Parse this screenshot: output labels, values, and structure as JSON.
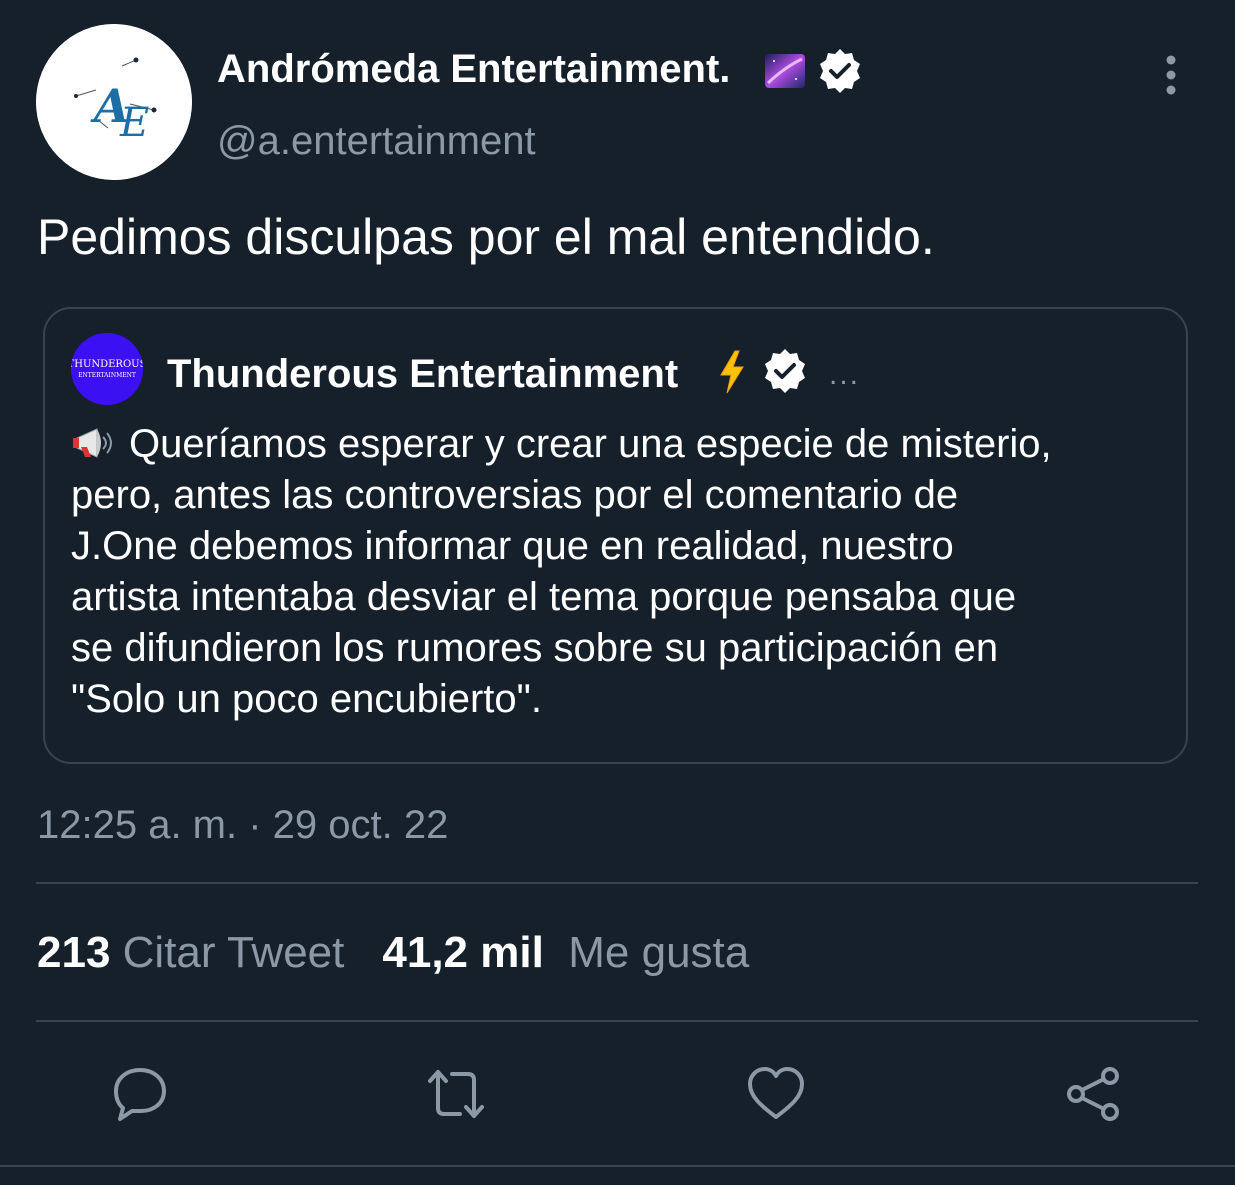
{
  "author": {
    "display_name": "Andrómeda Entertainment.",
    "handle": "@a.entertainment",
    "avatar_monogram": "AE",
    "verified": true,
    "name_emoji": "milky-way-icon"
  },
  "tweet": {
    "text": "Pedimos disculpas por el mal entendido.",
    "timestamp": "12:25 a. m. · 29 oct. 22"
  },
  "quoted_tweet": {
    "display_name": "Thunderous Entertainment",
    "avatar_text_line1": "THUNDEROUS",
    "avatar_text_line2": "ENTERTAINMENT",
    "name_emoji": "lightning-icon",
    "verified": true,
    "more_label": "...",
    "body_emoji": "megaphone-icon",
    "body": "Queríamos esperar y crear una especie de misterio,\npero, antes las controversias por el comentario de\nJ.One debemos informar que en realidad, nuestro\nartista intentaba desviar el tema porque pensaba que\nse difundieron los rumores sobre su participación en\n\"Solo un poco encubierto\"."
  },
  "stats": {
    "quote_count": "213",
    "quote_label": "Citar Tweet",
    "like_count": "41,2 mil",
    "like_label": "Me gusta"
  },
  "actions": [
    "reply-icon",
    "retweet-icon",
    "like-icon",
    "share-icon"
  ],
  "colors": {
    "background": "#15202b",
    "text_primary": "#ffffff",
    "text_secondary": "#8b98a5",
    "border": "#38444d",
    "avatar_logo_blue": "#1c6fa6",
    "quote_avatar_bg": "#3b10f2"
  }
}
